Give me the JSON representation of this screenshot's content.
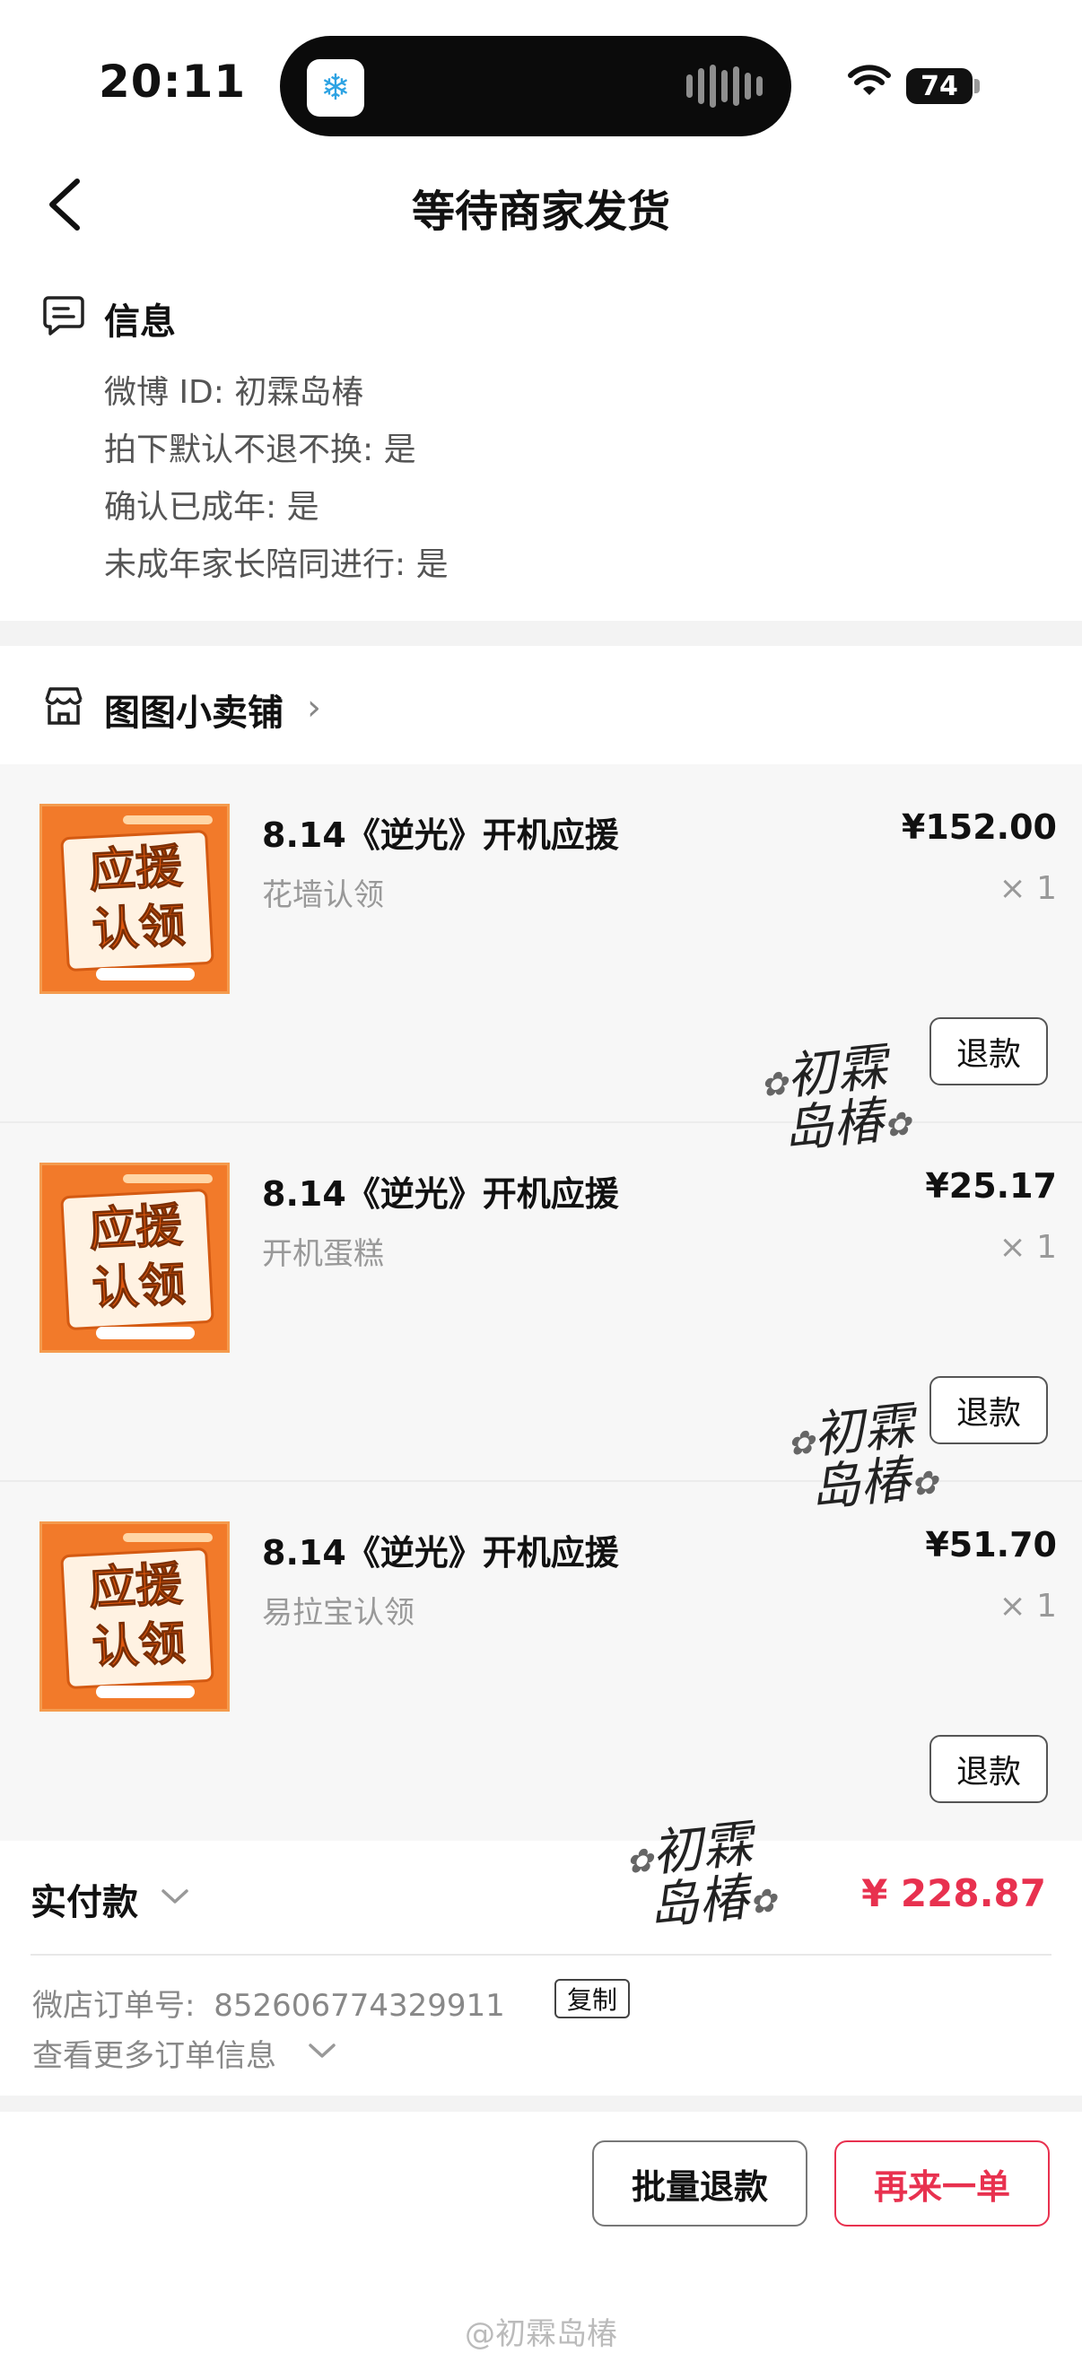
{
  "status_bar": {
    "time": "20:11",
    "battery": "74",
    "island_app_icon": "snowflake-icon"
  },
  "nav": {
    "title": "等待商家发货",
    "back_icon": "chevron-left-icon"
  },
  "info": {
    "title": "信息",
    "icon": "message-icon",
    "lines": [
      "微博 ID: 初霖岛椿",
      "拍下默认不退不换: 是",
      "确认已成年: 是",
      "未成年家长陪同进行: 是"
    ]
  },
  "shop": {
    "name": "图图小卖铺",
    "icon": "shop-icon",
    "arrow": "›"
  },
  "products": [
    {
      "title": "8.14《逆光》开机应援",
      "variant": "花墙认领",
      "price": "¥152.00",
      "qty": "× 1",
      "refund_label": "退款",
      "thumb_text_1": "应援",
      "thumb_text_2": "认领"
    },
    {
      "title": "8.14《逆光》开机应援",
      "variant": "开机蛋糕",
      "price": "¥25.17",
      "qty": "× 1",
      "refund_label": "退款",
      "thumb_text_1": "应援",
      "thumb_text_2": "认领"
    },
    {
      "title": "8.14《逆光》开机应援",
      "variant": "易拉宝认领",
      "price": "¥51.70",
      "qty": "× 1",
      "refund_label": "退款",
      "thumb_text_1": "应援",
      "thumb_text_2": "认领"
    }
  ],
  "watermark": {
    "line1": "初霖",
    "line2": "岛椿"
  },
  "summary": {
    "total_label": "实付款",
    "total_amount": "¥ 228.87",
    "order_no_label": "微店订单号:",
    "order_no": "852606774329911",
    "copy_label": "复制",
    "more_info_label": "查看更多订单信息"
  },
  "actions": {
    "batch_refund": "批量退款",
    "reorder": "再来一单"
  },
  "footer": {
    "watermark": "@初霖岛椿"
  },
  "colors": {
    "accent_red": "#e8314f",
    "thumb_orange": "#f27a2a"
  }
}
